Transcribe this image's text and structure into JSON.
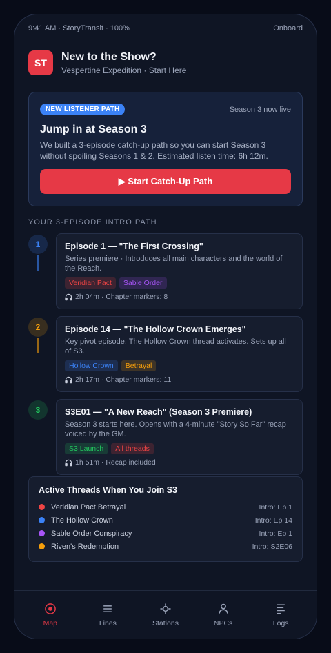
{
  "status": {
    "left": "9:41 AM · StoryTransit · 100%",
    "right": "Onboard"
  },
  "header": {
    "logo": "ST",
    "title": "New to the Show?",
    "subtitle": "Vespertine Expedition · Start Here"
  },
  "hero": {
    "badge": "NEW LISTENER PATH",
    "note": "Season 3 now live",
    "title": "Jump in at Season 3",
    "description": "We built a 3-episode catch-up path so you can start Season 3 without spoiling Seasons 1 & 2. Estimated listen time: 6h 12m.",
    "cta": "▶ Start Catch-Up Path"
  },
  "path_label": "YOUR 3-EPISODE INTRO PATH",
  "steps": [
    {
      "num": "1",
      "color": "#3b82f6",
      "title": "Episode 1 — \"The First Crossing\"",
      "desc": "Series premiere · Introduces all main characters and the world of the Reach.",
      "tags": [
        {
          "label": "Veridian Pact",
          "color": "#ef4444"
        },
        {
          "label": "Sable Order",
          "color": "#a855f7"
        }
      ],
      "meta": "2h 04m · Chapter markers: 8"
    },
    {
      "num": "2",
      "color": "#f59e0b",
      "title": "Episode 14 — \"The Hollow Crown Emerges\"",
      "desc": "Key pivot episode. The Hollow Crown thread activates. Sets up all of S3.",
      "tags": [
        {
          "label": "Hollow Crown",
          "color": "#3b82f6"
        },
        {
          "label": "Betrayal",
          "color": "#f59e0b"
        }
      ],
      "meta": "2h 17m · Chapter markers: 11"
    },
    {
      "num": "3",
      "color": "#22c55e",
      "title": "S3E01 — \"A New Reach\" (Season 3 Premiere)",
      "desc": "Season 3 starts here. Opens with a 4-minute \"Story So Far\" recap voiced by the GM.",
      "tags": [
        {
          "label": "S3 Launch",
          "color": "#22c55e"
        },
        {
          "label": "All threads",
          "color": "#ef4444"
        }
      ],
      "meta": "1h 51m · Recap included"
    }
  ],
  "threads": {
    "title": "Active Threads When You Join S3",
    "items": [
      {
        "name": "Veridian Pact Betrayal",
        "intro": "Intro: Ep 1",
        "color": "#ef4444"
      },
      {
        "name": "The Hollow Crown",
        "intro": "Intro: Ep 14",
        "color": "#3b82f6"
      },
      {
        "name": "Sable Order Conspiracy",
        "intro": "Intro: Ep 1",
        "color": "#a855f7"
      },
      {
        "name": "Riven's Redemption",
        "intro": "Intro: S2E06",
        "color": "#f59e0b"
      }
    ]
  },
  "tabs": [
    {
      "label": "Map",
      "icon": "map-icon",
      "active": true
    },
    {
      "label": "Lines",
      "icon": "lines-icon",
      "active": false
    },
    {
      "label": "Stations",
      "icon": "stations-icon",
      "active": false
    },
    {
      "label": "NPCs",
      "icon": "npcs-icon",
      "active": false
    },
    {
      "label": "Logs",
      "icon": "logs-icon",
      "active": false
    }
  ],
  "colors": {
    "accent": "#e63946",
    "badge": "#3b82f6"
  }
}
